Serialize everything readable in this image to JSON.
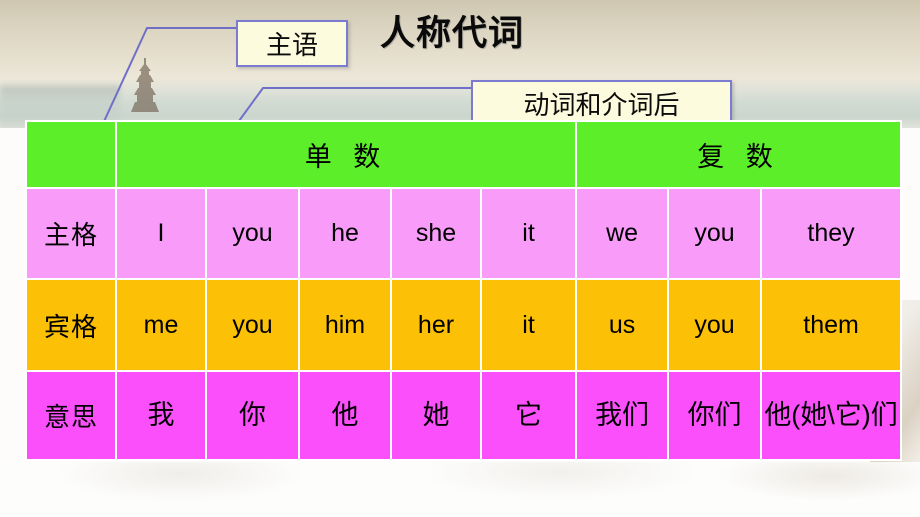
{
  "slide": {
    "title": "人称代词",
    "background": {
      "scene": "pagoda-landscape",
      "pagoda_label": "pagoda-silhouette"
    }
  },
  "callouts": [
    {
      "id": "subject",
      "text": "主语",
      "border_color": "#7b7bd0",
      "fill_color": "#fdfbdd"
    },
    {
      "id": "object",
      "text": "动词和介词后",
      "border_color": "#7b7bd0",
      "fill_color": "#fdfbdd"
    }
  ],
  "table": {
    "colors": {
      "header": "#5bee29",
      "subjective_row": "#f99cf9",
      "objective_row": "#fcc006",
      "meaning_row": "#fb4ffb",
      "grid": "#ffffff"
    },
    "header": {
      "corner": "",
      "singular": "单 数",
      "plural": "复 数"
    },
    "rows": [
      {
        "label": "主格",
        "cells": [
          "I",
          "you",
          "he",
          "she",
          "it",
          "we",
          "you",
          "they"
        ]
      },
      {
        "label": "宾格",
        "cells": [
          "me",
          "you",
          "him",
          "her",
          "it",
          "us",
          "you",
          "them"
        ]
      },
      {
        "label": "意思",
        "cells": [
          "我",
          "你",
          "他",
          "她",
          "它",
          "我们",
          "你们",
          "他(她\\它)们"
        ]
      }
    ]
  }
}
